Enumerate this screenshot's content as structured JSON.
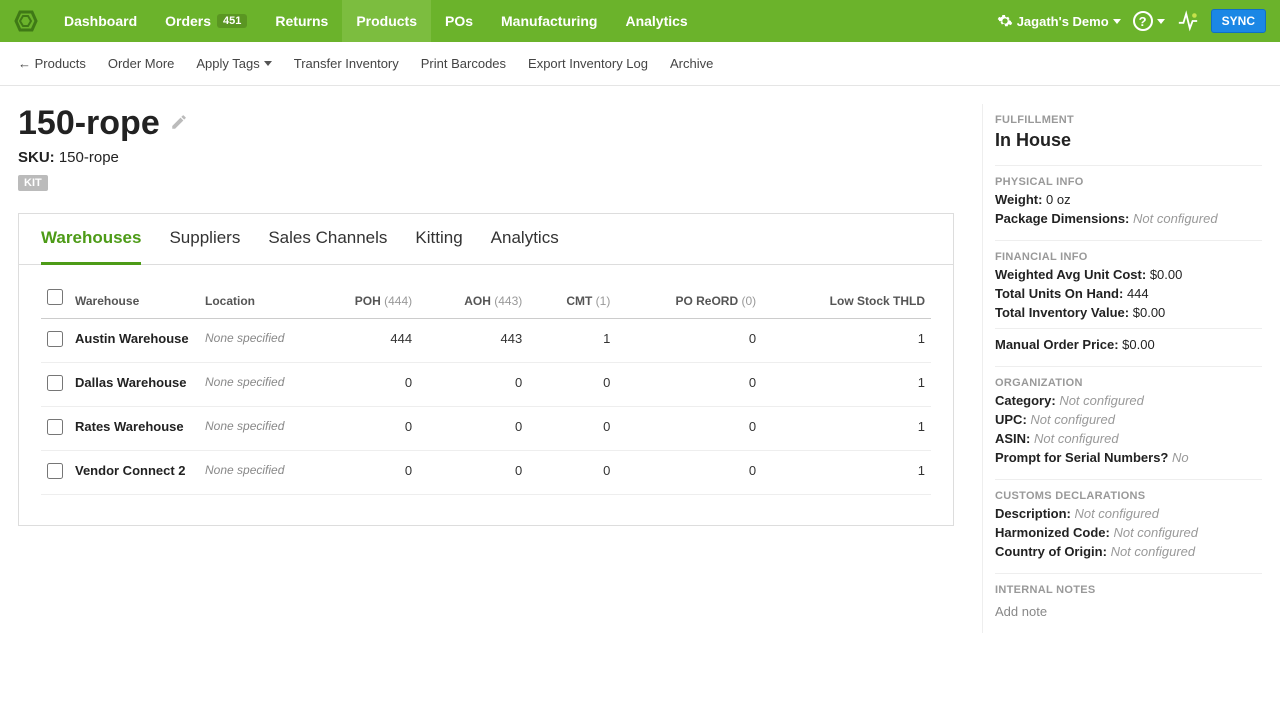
{
  "topnav": {
    "items": [
      {
        "label": "Dashboard"
      },
      {
        "label": "Orders",
        "badge": "451"
      },
      {
        "label": "Returns"
      },
      {
        "label": "Products",
        "active": true
      },
      {
        "label": "POs"
      },
      {
        "label": "Manufacturing"
      },
      {
        "label": "Analytics"
      }
    ],
    "account_label": "Jagath's Demo",
    "sync_label": "SYNC"
  },
  "subnav": {
    "back_label": "← Products",
    "items": [
      "Order More",
      "Apply Tags",
      "Transfer Inventory",
      "Print Barcodes",
      "Export Inventory Log",
      "Archive"
    ]
  },
  "product": {
    "title": "150-rope",
    "sku_label": "SKU:",
    "sku_value": "150-rope",
    "kit_badge": "KIT"
  },
  "tabs": [
    {
      "label": "Warehouses",
      "active": true
    },
    {
      "label": "Suppliers"
    },
    {
      "label": "Sales Channels"
    },
    {
      "label": "Kitting"
    },
    {
      "label": "Analytics"
    }
  ],
  "table": {
    "headers": {
      "warehouse": "Warehouse",
      "location": "Location",
      "poh": "POH",
      "poh_sub": "(444)",
      "aoh": "AOH",
      "aoh_sub": "(443)",
      "cmt": "CMT",
      "cmt_sub": "(1)",
      "reord": "PO ReORD",
      "reord_sub": "(0)",
      "thld": "Low Stock THLD"
    },
    "rows": [
      {
        "name": "Austin Warehouse",
        "location": "None specified",
        "poh": "444",
        "aoh": "443",
        "cmt": "1",
        "reord": "0",
        "thld": "1"
      },
      {
        "name": "Dallas Warehouse",
        "location": "None specified",
        "poh": "0",
        "aoh": "0",
        "cmt": "0",
        "reord": "0",
        "thld": "1"
      },
      {
        "name": "Rates Warehouse",
        "location": "None specified",
        "poh": "0",
        "aoh": "0",
        "cmt": "0",
        "reord": "0",
        "thld": "1"
      },
      {
        "name": "Vendor Connect 2",
        "location": "None specified",
        "poh": "0",
        "aoh": "0",
        "cmt": "0",
        "reord": "0",
        "thld": "1"
      }
    ]
  },
  "sidebar": {
    "fulfillment": {
      "head": "FULFILLMENT",
      "value": "In House"
    },
    "physical": {
      "head": "PHYSICAL INFO",
      "weight_label": "Weight:",
      "weight_value": "0 oz",
      "dim_label": "Package Dimensions:",
      "dim_value": "Not configured"
    },
    "financial": {
      "head": "FINANCIAL INFO",
      "wauc_label": "Weighted Avg Unit Cost:",
      "wauc_value": "$0.00",
      "tuoh_label": "Total Units On Hand:",
      "tuoh_value": "444",
      "tiv_label": "Total Inventory Value:",
      "tiv_value": "$0.00",
      "mop_label": "Manual Order Price:",
      "mop_value": "$0.00"
    },
    "organization": {
      "head": "ORGANIZATION",
      "cat_label": "Category:",
      "cat_value": "Not configured",
      "upc_label": "UPC:",
      "upc_value": "Not configured",
      "asin_label": "ASIN:",
      "asin_value": "Not configured",
      "serial_label": "Prompt for Serial Numbers?",
      "serial_value": "No"
    },
    "customs": {
      "head": "CUSTOMS DECLARATIONS",
      "desc_label": "Description:",
      "desc_value": "Not configured",
      "harm_label": "Harmonized Code:",
      "harm_value": "Not configured",
      "coo_label": "Country of Origin:",
      "coo_value": "Not configured"
    },
    "notes": {
      "head": "INTERNAL NOTES",
      "add": "Add note"
    }
  }
}
